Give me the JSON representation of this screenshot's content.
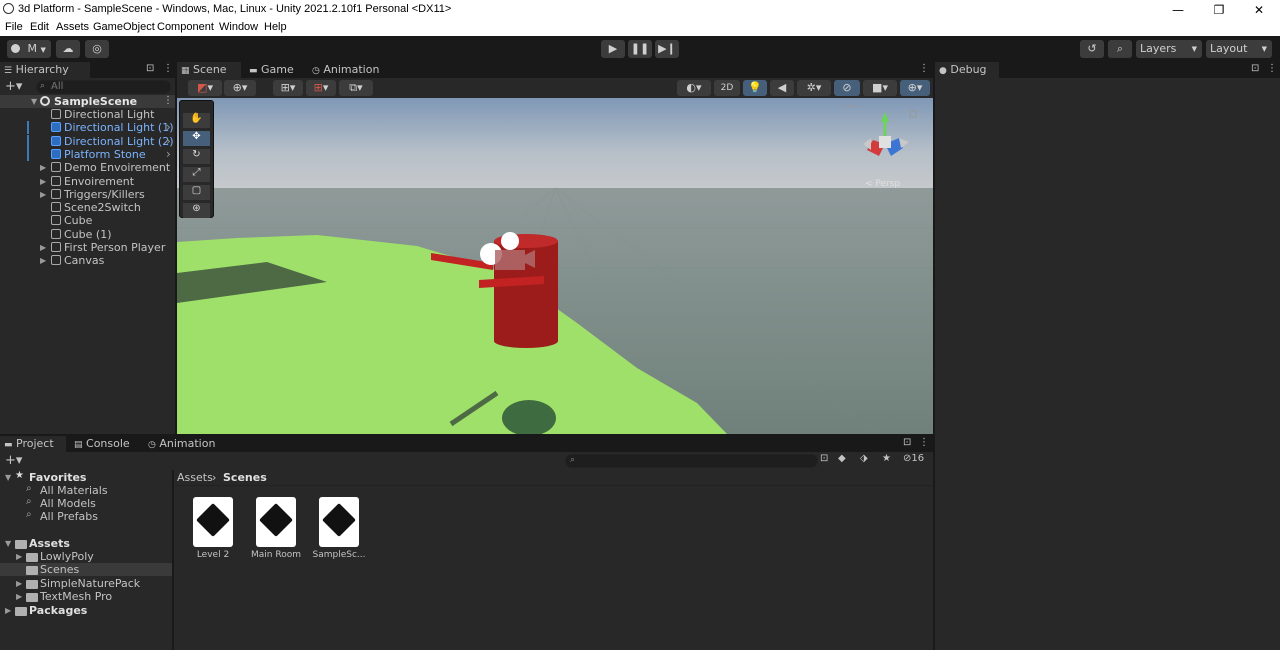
{
  "window": {
    "title": "3d Platform - SampleScene - Windows, Mac, Linux - Unity 2021.2.10f1 Personal <DX11>",
    "minimize": "—",
    "maximize": "❐",
    "close": "✕"
  },
  "menu": [
    "File",
    "Edit",
    "Assets",
    "GameObject",
    "Component",
    "Window",
    "Help"
  ],
  "toolbar": {
    "account": "M",
    "layers": "Layers",
    "layout": "Layout"
  },
  "hierarchy": {
    "tab": "Hierarchy",
    "search_placeholder": "All",
    "scene": "SampleScene",
    "items": [
      {
        "label": "Directional Light",
        "selected": false
      },
      {
        "label": "Directional Light (1)",
        "selected": true
      },
      {
        "label": "Directional Light (2)",
        "selected": true
      },
      {
        "label": "Platform Stone",
        "selected": true
      },
      {
        "label": "Demo Envoirement",
        "selected": false
      },
      {
        "label": "Envoirement",
        "selected": false
      },
      {
        "label": "Triggers/Killers",
        "selected": false
      },
      {
        "label": "Scene2Switch",
        "selected": false
      },
      {
        "label": "Cube",
        "selected": false
      },
      {
        "label": "Cube (1)",
        "selected": false
      },
      {
        "label": "First Person Player",
        "selected": false
      },
      {
        "label": "Canvas",
        "selected": false
      }
    ]
  },
  "center_tabs": [
    "Scene",
    "Game",
    "Animation"
  ],
  "scene_toolbar": {
    "twod": "2D"
  },
  "gizmo": {
    "persp": "< Persp"
  },
  "debug": {
    "tab": "Debug"
  },
  "bottom_tabs": [
    "Project",
    "Console",
    "Animation"
  ],
  "project": {
    "hidden_count": "16",
    "favorites": {
      "label": "Favorites",
      "items": [
        "All Materials",
        "All Models",
        "All Prefabs"
      ]
    },
    "assets": {
      "label": "Assets",
      "items": [
        "LowlyPoly",
        "Scenes",
        "SimpleNaturePack",
        "TextMesh Pro"
      ]
    },
    "packages": "Packages",
    "breadcrumb": [
      "Assets",
      "Scenes"
    ],
    "files": [
      "Level 2",
      "Main Room",
      "SampleSc..."
    ]
  }
}
